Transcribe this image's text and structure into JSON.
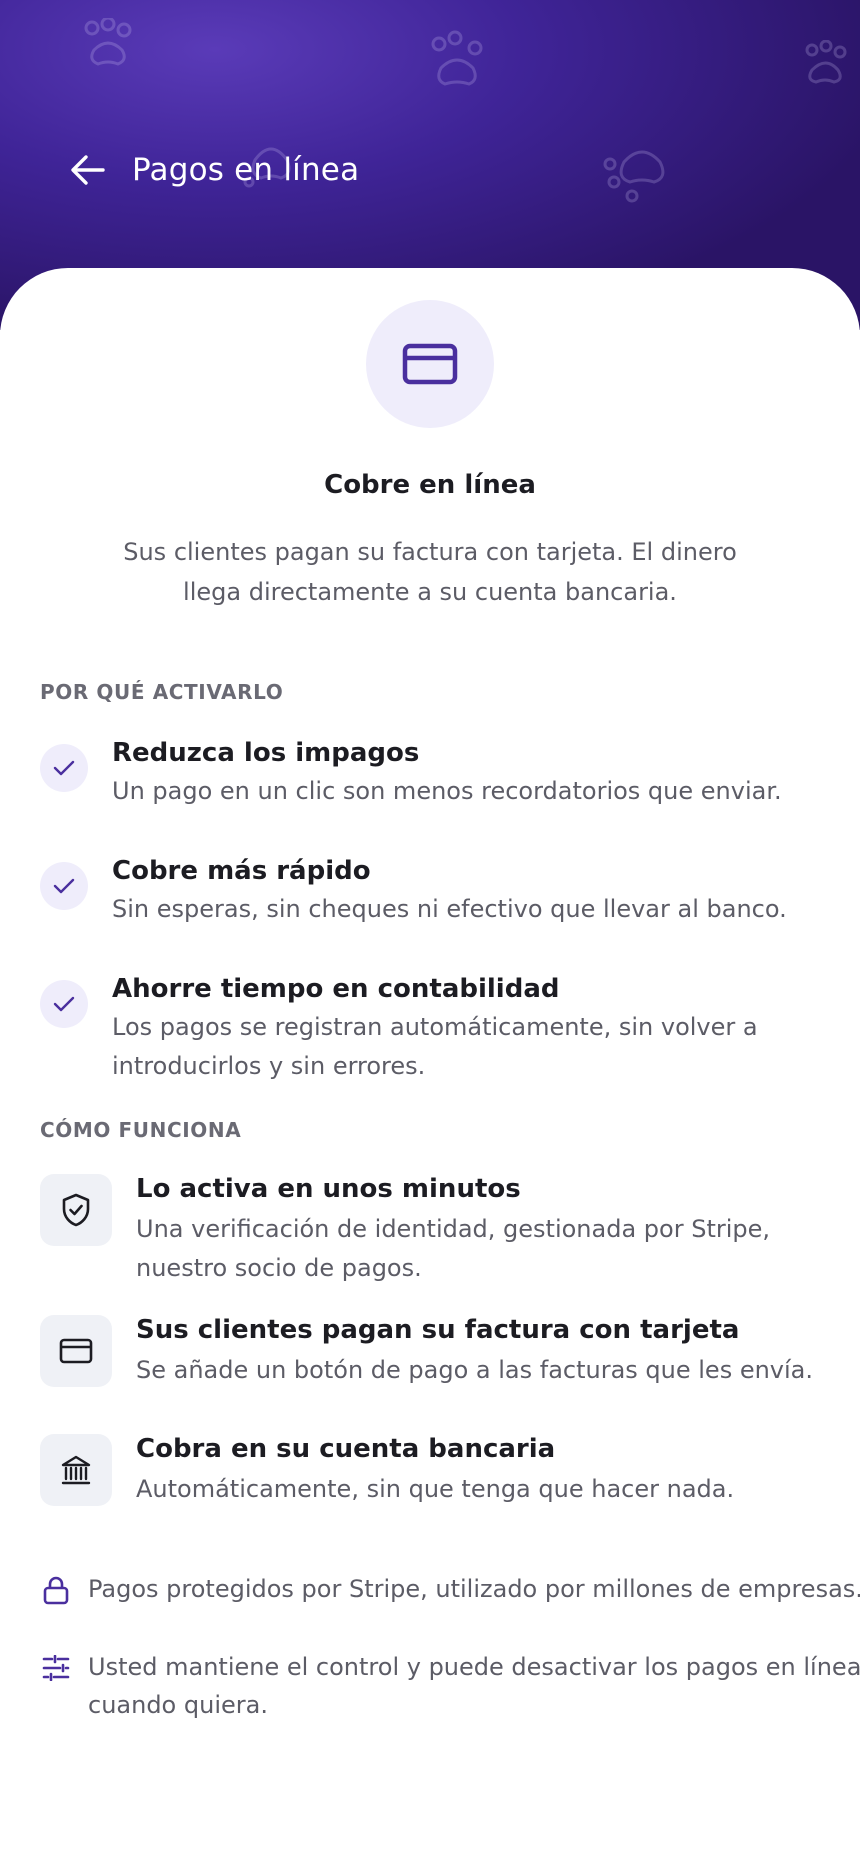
{
  "header": {
    "title": "Pagos en línea",
    "back_icon": "arrow-left-icon",
    "background_colors": [
      "#5a3bb8",
      "#2a1466"
    ]
  },
  "hero": {
    "icon": "credit-card-icon",
    "title": "Cobre en línea",
    "subtitle": "Sus clientes pagan su factura con tarjeta. El dinero llega directamente a su cuenta bancaria."
  },
  "benefits": {
    "label": "POR QUÉ ACTIVARLO",
    "items": [
      {
        "title": "Reduzca los impagos",
        "desc": "Un pago en un clic son menos recordatorios que enviar."
      },
      {
        "title": "Cobre más rápido",
        "desc": "Sin esperas, sin cheques ni efectivo que llevar al banco."
      },
      {
        "title": "Ahorre tiempo en contabilidad",
        "desc": "Los pagos se registran automáticamente, sin volver a introducirlos y sin errores."
      }
    ]
  },
  "how": {
    "label": "CÓMO FUNCIONA",
    "items": [
      {
        "icon": "shield-check-icon",
        "title": "Lo activa en unos minutos",
        "desc": "Una verificación de identidad, gestionada por Stripe, nuestro socio de pagos."
      },
      {
        "icon": "credit-card-icon",
        "title": "Sus clientes pagan su factura con tarjeta",
        "desc": "Se añade un botón de pago a las facturas que les envía."
      },
      {
        "icon": "bank-icon",
        "title": "Cobra en su cuenta bancaria",
        "desc": "Automáticamente, sin que tenga que hacer nada."
      }
    ]
  },
  "notes": [
    {
      "icon": "lock-icon",
      "text": "Pagos protegidos por Stripe, utilizado por millones de empresas."
    },
    {
      "icon": "sliders-icon",
      "text": "Usted mantiene el control y puede desactivar los pagos en línea cuando quiera."
    }
  ],
  "colors": {
    "accent": "#4a2f9e",
    "accent_soft": "#efedfb",
    "step_bg": "#eff1f6",
    "text_primary": "#1c1c22",
    "text_secondary": "#5c5c66"
  }
}
